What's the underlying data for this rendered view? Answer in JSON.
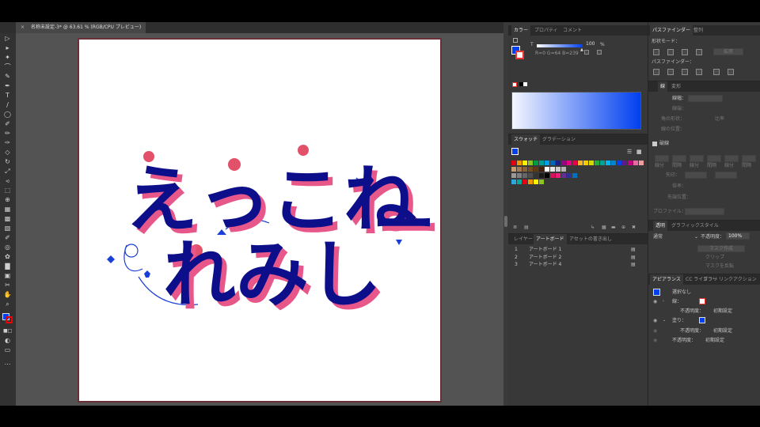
{
  "document": {
    "tab_title": "名称未設定-3* @ 63.61 % (RGB/CPU プレビュー)",
    "close_glyph": "×"
  },
  "color_panel": {
    "tabs": [
      "カラー",
      "プロパティ",
      "コメント"
    ],
    "channel_label": "T",
    "tint_value": "100",
    "tint_unit": "%",
    "rgb_readout": "R=0 G=64 B=239",
    "fill_color": "#0040ef",
    "tint_position": 1.0
  },
  "swatches_panel": {
    "tabs": [
      "スウォッチ",
      "グラデーション"
    ]
  },
  "layers_panel": {
    "tabs": [
      "レイヤー",
      "アートボード",
      "アセットの書き出し"
    ],
    "artboards": [
      {
        "num": "1",
        "name": "アートボード 1"
      },
      {
        "num": "2",
        "name": "アートボード 2"
      },
      {
        "num": "3",
        "name": "アートボード 4"
      }
    ]
  },
  "pathfinder_panel": {
    "tabs": [
      "パスファインダー",
      "整列"
    ],
    "shape_mode_label": "形状モード：",
    "expand_label": "拡張",
    "pathfinder_label": "パスファインダー："
  },
  "stroke_panel": {
    "tabs": [
      "線",
      "変形"
    ],
    "weight_label": "線幅：",
    "cap_label": "線端：",
    "corner_label": "角の形状：",
    "limit_label": "比率",
    "align_label": "線の位置：",
    "dashed_label": "破線",
    "dash_labels": [
      "線分",
      "間隔",
      "線分",
      "間隔",
      "線分",
      "間隔"
    ],
    "arrow_label": "矢印：",
    "scale_label": "倍率：",
    "align_arrow_label": "先端位置：",
    "profile_label": "プロファイル："
  },
  "transparency_panel": {
    "tabs": [
      "透明",
      "グラフィックスタイル"
    ],
    "blend_mode": "通常",
    "opacity_label": "不透明度：",
    "opacity_value": "100%",
    "make_mask": "マスク作成",
    "clip": "クリップ",
    "invert_mask": "マスクを反転"
  },
  "appearance_panel": {
    "tabs": [
      "アピアランス",
      "CC ライブラリ",
      "カラー",
      "リンク",
      "アクション"
    ],
    "selection": "選択なし",
    "stroke_label": "線：",
    "fill_label": "塗り：",
    "opacity_label": "不透明度：",
    "default_value": "初期設定",
    "fill_color": "#0040ef"
  },
  "artwork": {
    "line1": "えっこね",
    "line2": "れみし",
    "dash": "ー",
    "fill_color": "#0d0f8a",
    "shadow_color": "#e8578a",
    "dot_color": "#e2506a",
    "accent_color": "#1a3fd8"
  }
}
